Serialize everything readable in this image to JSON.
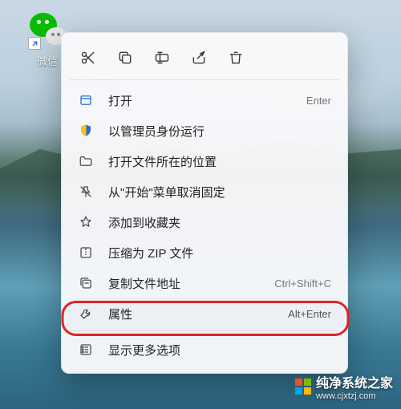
{
  "desktop": {
    "icon_label": "微信"
  },
  "context_menu": {
    "toolbar": [
      {
        "name": "cut-icon"
      },
      {
        "name": "copy-icon"
      },
      {
        "name": "rename-icon"
      },
      {
        "name": "share-icon"
      },
      {
        "name": "delete-icon"
      }
    ],
    "items": [
      {
        "icon": "open-icon",
        "label": "打开",
        "shortcut": "Enter"
      },
      {
        "icon": "shield-icon",
        "label": "以管理员身份运行",
        "shortcut": ""
      },
      {
        "icon": "folder-icon",
        "label": "打开文件所在的位置",
        "shortcut": ""
      },
      {
        "icon": "unpin-icon",
        "label": "从\"开始\"菜单取消固定",
        "shortcut": ""
      },
      {
        "icon": "star-icon",
        "label": "添加到收藏夹",
        "shortcut": ""
      },
      {
        "icon": "zip-icon",
        "label": "压缩为 ZIP 文件",
        "shortcut": ""
      },
      {
        "icon": "copy-path-icon",
        "label": "复制文件地址",
        "shortcut": "Ctrl+Shift+C"
      },
      {
        "icon": "wrench-icon",
        "label": "属性",
        "shortcut": "Alt+Enter",
        "highlighted": true
      },
      {
        "icon": "more-icon",
        "label": "显示更多选项",
        "shortcut": ""
      }
    ]
  },
  "watermark": {
    "text": "纯净系统之家",
    "url": "www.cjxtzj.com"
  }
}
